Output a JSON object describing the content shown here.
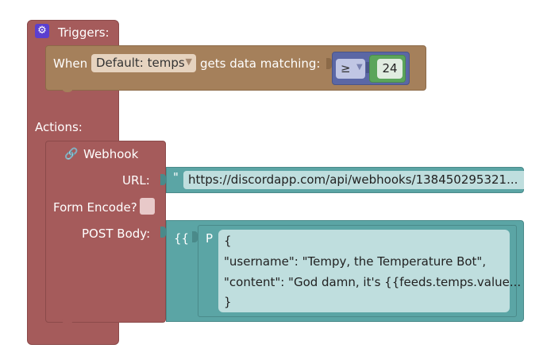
{
  "triggers": {
    "label": "Triggers:",
    "icon": "gear-icon",
    "when_label": "When",
    "feed_value": "Default: temps",
    "gets_label": "gets data matching:",
    "operator": "≥",
    "threshold": "24"
  },
  "actions": {
    "label": "Actions:",
    "webhook": {
      "title": "Webhook",
      "icon": "link-icon",
      "url_label": "URL:",
      "url_quote": "\"",
      "url_value": "https://discordapp.com/api/webhooks/138450295321...",
      "form_encode_label": "Form Encode?",
      "post_body_label": "POST Body:",
      "template_marker": "{{",
      "param_marker": "P",
      "body_lines": [
        "{",
        "\"username\": \"Tempy, the Temperature Bot\",",
        "\"content\": \"God damn, it's {{feeds.temps.value...",
        "}"
      ]
    }
  }
}
